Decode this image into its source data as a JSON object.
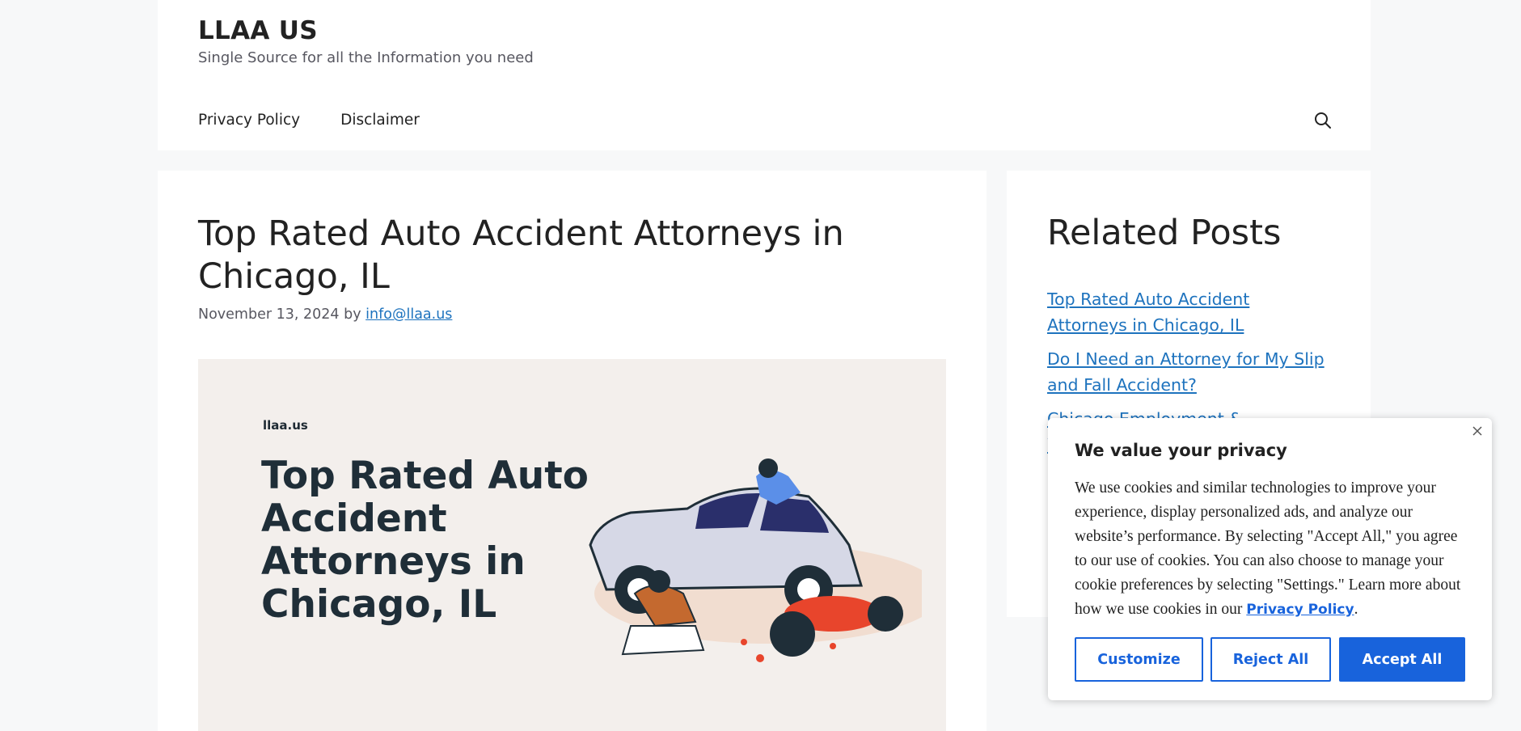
{
  "site": {
    "title": "LLAA US",
    "tagline": "Single Source for all the Information you need"
  },
  "nav": {
    "items": [
      "Privacy Policy",
      "Disclaimer"
    ],
    "search_icon": "search-icon"
  },
  "article": {
    "title": "Top Rated Auto Accident Attorneys in Chicago, IL",
    "date": "November 13, 2024",
    "by": "by",
    "author": "info@llaa.us",
    "hero": {
      "brand": "llaa.us",
      "title": "Top Rated Auto Accident Attorneys in Chicago, IL"
    }
  },
  "sidebar": {
    "heading": "Related Posts",
    "posts": [
      "Top Rated Auto Accident Attorneys in Chicago, IL",
      "Do I Need an Attorney for My Slip and Fall Accident?",
      "Chicago Employment & Workplace"
    ]
  },
  "cookie": {
    "title": "We value your privacy",
    "body": "We use cookies and similar technologies to improve your experience, display personalized ads, and analyze our website’s performance. By selecting \"Accept All,\" you agree to our use of cookies. You can also choose to manage your cookie preferences by selecting \"Settings.\" Learn more about how we use cookies in our",
    "link": "Privacy Policy",
    "period": ".",
    "customize": "Customize",
    "reject": "Reject All",
    "accept": "Accept All",
    "accent": "#1863dc"
  }
}
